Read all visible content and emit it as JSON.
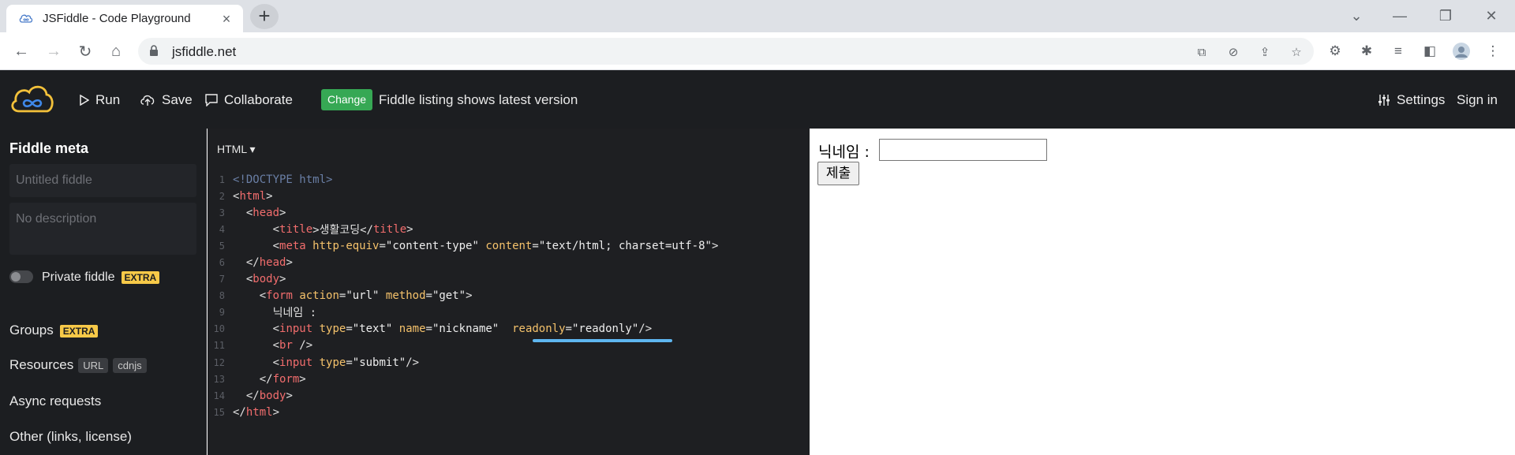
{
  "browser": {
    "tab_title": "JSFiddle - Code Playground",
    "url": "jsfiddle.net"
  },
  "header": {
    "run_label": "Run",
    "save_label": "Save",
    "collaborate_label": "Collaborate",
    "change_badge": "Change",
    "change_text": "Fiddle listing shows latest version",
    "settings_label": "Settings",
    "signin_label": "Sign in"
  },
  "sidebar": {
    "meta_title": "Fiddle meta",
    "title_placeholder": "Untitled fiddle",
    "description_placeholder": "No description",
    "private_label": "Private fiddle",
    "extra_badge": "EXTRA",
    "groups_label": "Groups",
    "resources_label": "Resources",
    "url_pill": "URL",
    "cdnjs_pill": "cdnjs",
    "async_label": "Async requests",
    "other_label": "Other (links, license)"
  },
  "editor": {
    "language": "HTML",
    "line_numbers": [
      "1",
      "2",
      "3",
      "4",
      "5",
      "6",
      "7",
      "8",
      "9",
      "10",
      "11",
      "12",
      "13",
      "14",
      "15"
    ]
  },
  "result": {
    "label": "닉네임 :",
    "submit_label": "제출"
  },
  "colors": {
    "header_bg": "#1c1e21",
    "change_badge": "#36a854",
    "extra_badge": "#f7c948",
    "underline": "#5eb6f0"
  }
}
